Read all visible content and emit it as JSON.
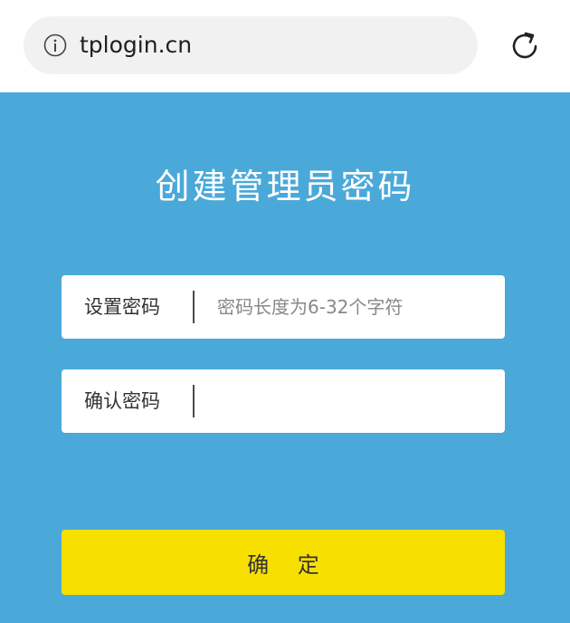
{
  "browser": {
    "url": "tplogin.cn",
    "info_icon": "info-icon",
    "reload_icon": "reload-icon"
  },
  "page": {
    "title": "创建管理员密码",
    "background_color": "#4aa9d9",
    "fields": [
      {
        "label": "设置密码",
        "value": "",
        "placeholder": "密码长度为6-32个字符"
      },
      {
        "label": "确认密码",
        "value": "",
        "placeholder": ""
      }
    ],
    "confirm_button": {
      "label": "确 定",
      "color": "#f7e000"
    }
  }
}
